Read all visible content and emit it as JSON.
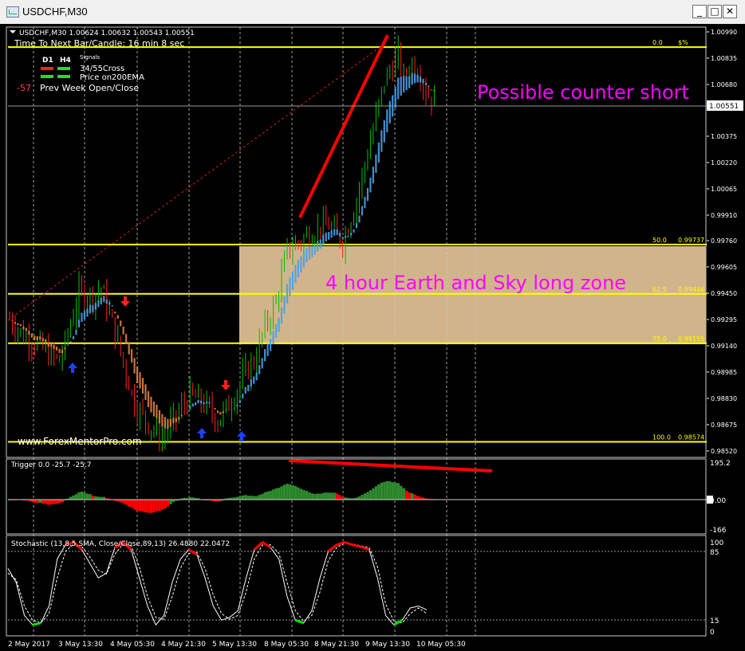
{
  "window": {
    "title": "USDCHF,M30",
    "minimize_glyph": "_",
    "maximize_glyph": "□",
    "close_glyph": "✕",
    "icon": "chart-window-icon"
  },
  "header": {
    "symbol_line": "USDCHF,M30  1.00624 1.00632 1.00543 1.00551",
    "time_to_next": "Time To Next Bar/Candle: 16 min 8 sec",
    "signals_label": "Signals",
    "tf_d1": "D1",
    "tf_h4": "H4",
    "cross_label": "34/55Cross",
    "ema_label": "Price on200EMA",
    "prev_week_value": "-57",
    "prev_week_label": "Prev Week Open/Close"
  },
  "watermark": "www.ForexMentorPro.com",
  "annotations": {
    "counter_short": "Possible counter short",
    "zone": "4 hour Earth and Sky long zone"
  },
  "fib_levels": [
    {
      "label": "0.0",
      "value": "$%"
    },
    {
      "label": "50.0",
      "value": "0.99737"
    },
    {
      "label": "62.5",
      "value": "0.99446"
    },
    {
      "label": "75.0",
      "value": "0.99155"
    },
    {
      "label": "100.0",
      "value": "0.98574"
    }
  ],
  "colors": {
    "background": "#000000",
    "grid": "#c8c8c8",
    "fib_line": "#ffff00",
    "zone_fill": "#d2b48c",
    "annotation_text": "#ff00ff",
    "trendline": "#ff0000",
    "ribbon_blue": "#4aa0e8",
    "ribbon_orange": "#e08040",
    "histogram_green": "#2e8b2e",
    "histogram_red": "#ff0000",
    "stoch_overbought": "#ff0000",
    "stoch_oversold": "#00e000",
    "arrow_up": "#0000ff",
    "arrow_down": "#ff0000"
  },
  "chart_data": [
    {
      "type": "candlestick",
      "title": "USDCHF,M30",
      "price_axis_labels": [
        "1.00990",
        "1.00835",
        "1.00680",
        "1.00551",
        "1.00375",
        "1.00220",
        "1.00065",
        "0.99910",
        "0.99760",
        "0.99605",
        "0.99450",
        "0.99295",
        "0.99140",
        "0.98985",
        "0.98830",
        "0.98675",
        "0.98520"
      ],
      "current_price": "1.00551",
      "ylim": [
        0.9852,
        1.0099
      ],
      "x_labels": [
        "2 May 2017",
        "3 May 13:30",
        "4 May 05:30",
        "4 May 21:30",
        "5 May 13:30",
        "8 May 05:30",
        "8 May 21:30",
        "9 May 13:30",
        "10 May 05:30"
      ],
      "close_path": [
        [
          0,
          0.993
        ],
        [
          5,
          0.992
        ],
        [
          10,
          0.9915
        ],
        [
          15,
          0.9908
        ],
        [
          18,
          0.9905
        ],
        [
          20,
          0.9915
        ],
        [
          25,
          0.9945
        ],
        [
          30,
          0.9943
        ],
        [
          33,
          0.9948
        ],
        [
          35,
          0.9938
        ],
        [
          40,
          0.991
        ],
        [
          45,
          0.988
        ],
        [
          50,
          0.9868
        ],
        [
          55,
          0.986
        ],
        [
          60,
          0.9872
        ],
        [
          65,
          0.9885
        ],
        [
          70,
          0.988
        ],
        [
          75,
          0.987
        ],
        [
          80,
          0.9882
        ],
        [
          85,
          0.9898
        ],
        [
          88,
          0.9905
        ],
        [
          92,
          0.9925
        ],
        [
          96,
          0.994
        ],
        [
          100,
          0.997
        ],
        [
          108,
          0.998
        ],
        [
          115,
          0.9985
        ],
        [
          120,
          0.9975
        ],
        [
          125,
          1.0
        ],
        [
          130,
          1.0035
        ],
        [
          135,
          1.007
        ],
        [
          140,
          1.0085
        ],
        [
          142,
          1.007
        ],
        [
          145,
          1.008
        ],
        [
          148,
          1.0075
        ],
        [
          150,
          1.0064
        ],
        [
          153,
          1.0058
        ]
      ]
    },
    {
      "type": "bar",
      "title": "Trigger 0.0 -25.7 -25.7",
      "axis_labels": [
        "195.2",
        "0.00",
        "-166"
      ],
      "ylim": [
        -166,
        195.2
      ]
    },
    {
      "type": "line",
      "title": "Stochastic (13,8,5,SMA, Close/Close,89,13) 26.4880 22.0472",
      "axis_labels": [
        "100",
        "85",
        "15",
        "0"
      ],
      "ylim": [
        0,
        100
      ],
      "levels": [
        85,
        15
      ],
      "series": [
        {
          "name": "Main",
          "values": [
            70,
            55,
            20,
            10,
            12,
            30,
            80,
            95,
            98,
            90,
            75,
            60,
            65,
            92,
            98,
            90,
            60,
            30,
            10,
            20,
            55,
            80,
            90,
            85,
            60,
            30,
            15,
            18,
            25,
            60,
            90,
            98,
            92,
            80,
            40,
            15,
            12,
            25,
            60,
            88,
            95,
            98,
            95,
            93,
            90,
            60,
            20,
            10,
            15,
            28,
            30,
            26
          ]
        },
        {
          "name": "Signal",
          "values": [
            65,
            58,
            30,
            15,
            12,
            22,
            60,
            88,
            96,
            93,
            82,
            68,
            64,
            85,
            96,
            94,
            72,
            40,
            18,
            16,
            40,
            70,
            86,
            87,
            70,
            42,
            22,
            16,
            20,
            45,
            80,
            95,
            95,
            86,
            55,
            25,
            14,
            20,
            45,
            78,
            92,
            97,
            96,
            94,
            92,
            72,
            32,
            14,
            12,
            22,
            28,
            22
          ]
        }
      ]
    }
  ]
}
